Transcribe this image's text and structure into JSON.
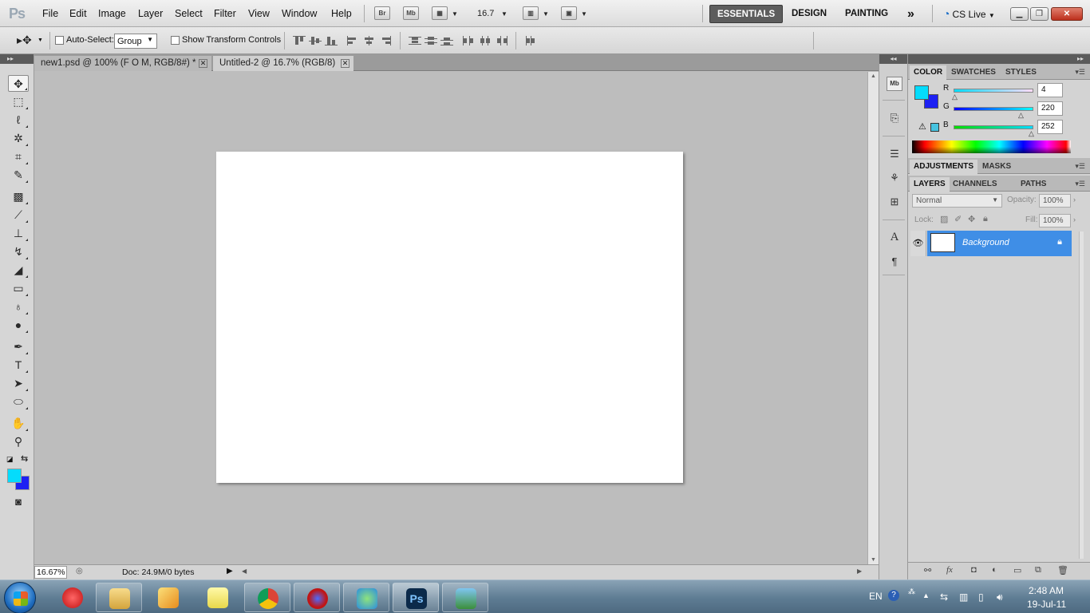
{
  "app": {
    "logo": "Ps"
  },
  "menu": [
    "File",
    "Edit",
    "Image",
    "Layer",
    "Select",
    "Filter",
    "View",
    "Window",
    "Help"
  ],
  "menubar_buttons": {
    "bridge": "Br",
    "mini_bridge": "Mb",
    "zoom": "16.7"
  },
  "workspaces": [
    "ESSENTIALS",
    "DESIGN",
    "PAINTING"
  ],
  "workspace_more": "»",
  "cslive": "CS Live",
  "window_controls": {
    "minimize": "▁",
    "restore": "❐",
    "close": "✕"
  },
  "options": {
    "auto_select_label": "Auto-Select:",
    "auto_select_value": "Group",
    "transform_label": "Show Transform Controls"
  },
  "doc_tabs": [
    {
      "title": "new1.psd @ 100% (F O M, RGB/8#) *",
      "close": "✕"
    },
    {
      "title": "Untitled-2 @ 16.7% (RGB/8)",
      "close": "✕"
    }
  ],
  "status": {
    "zoom": "16.67%",
    "doc": "Doc: 24.9M/0 bytes"
  },
  "color_panel": {
    "tabs": [
      "COLOR",
      "SWATCHES",
      "STYLES"
    ],
    "fg_color": "#04dcfc",
    "bg_color": "#1d21f3",
    "channels": [
      {
        "label": "R",
        "value": "4"
      },
      {
        "label": "G",
        "value": "220"
      },
      {
        "label": "B",
        "value": "252"
      }
    ]
  },
  "adjust_panel": {
    "tabs": [
      "ADJUSTMENTS",
      "MASKS"
    ]
  },
  "layers_panel": {
    "tabs": [
      "LAYERS",
      "CHANNELS",
      "PATHS"
    ],
    "blend_mode": "Normal",
    "opacity_label": "Opacity:",
    "opacity_value": "100%",
    "lock_label": "Lock:",
    "fill_label": "Fill:",
    "fill_value": "100%",
    "layers": [
      {
        "name": "Background",
        "locked": true,
        "visible": true
      }
    ]
  },
  "tray": {
    "language": "EN",
    "time": "2:48 AM",
    "date": "19-Jul-11"
  }
}
